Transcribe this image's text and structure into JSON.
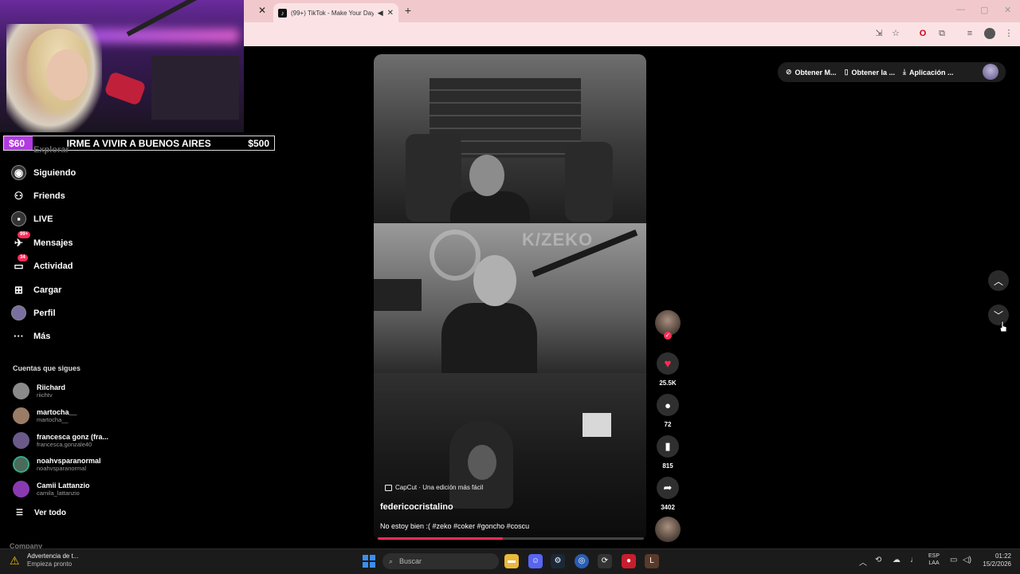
{
  "browser": {
    "tab_title": "(99+) TikTok - Make Your Day",
    "tab_favicon": "tiktok-icon"
  },
  "stream_goal": {
    "current": "$60",
    "title": "IRME A VIVIR A BUENOS AIRES",
    "target": "$500"
  },
  "sidebar": {
    "partial_item": "Explorar",
    "items": [
      {
        "label": "Siguiendo",
        "icon": "following-icon"
      },
      {
        "label": "Friends",
        "icon": "friends-icon"
      },
      {
        "label": "LIVE",
        "icon": "live-icon"
      },
      {
        "label": "Mensajes",
        "icon": "messages-icon",
        "badge": "99+"
      },
      {
        "label": "Actividad",
        "icon": "activity-icon",
        "badge": "34"
      },
      {
        "label": "Cargar",
        "icon": "upload-icon"
      },
      {
        "label": "Perfil",
        "icon": "profile-icon"
      },
      {
        "label": "Más",
        "icon": "more-icon"
      }
    ],
    "following_heading": "Cuentas que sigues",
    "accounts": [
      {
        "name": "Riichard",
        "handle": "riichtv"
      },
      {
        "name": "martocha__",
        "handle": "martocha__"
      },
      {
        "name": "francesca gonz (fra...",
        "handle": "francesca.gonzale40"
      },
      {
        "name": "noahvsparanormal",
        "handle": "noahvsparanormal"
      },
      {
        "name": "Camii Lattanzio",
        "handle": "camila_lattanzio"
      }
    ],
    "see_all": "Ver todo",
    "footer": "Company"
  },
  "video": {
    "watermark": "K/ZEKO",
    "capcut": "CapCut · Una edición más fácil",
    "author": "federicocristalino",
    "description": "No estoy bien :( #zeko #coker #goncho #coscu",
    "progress": 0.47
  },
  "actions": {
    "likes": "25.5K",
    "comments": "72",
    "saves": "815",
    "shares": "3402"
  },
  "top_bar": {
    "coins": "Obtener M...",
    "get_app": "Obtener la ...",
    "desktop_app": "Aplicación ..."
  },
  "taskbar": {
    "alert_title": "Advertencia de t...",
    "alert_sub": "Empieza pronto",
    "search_placeholder": "Buscar",
    "lang_1": "ESP",
    "lang_2": "LAA",
    "time": "01:22",
    "date": "15/2/2026"
  },
  "colors": {
    "accent": "#fe2c55",
    "goal": "#b23ae0",
    "tab_bar": "#f1c9cc"
  }
}
